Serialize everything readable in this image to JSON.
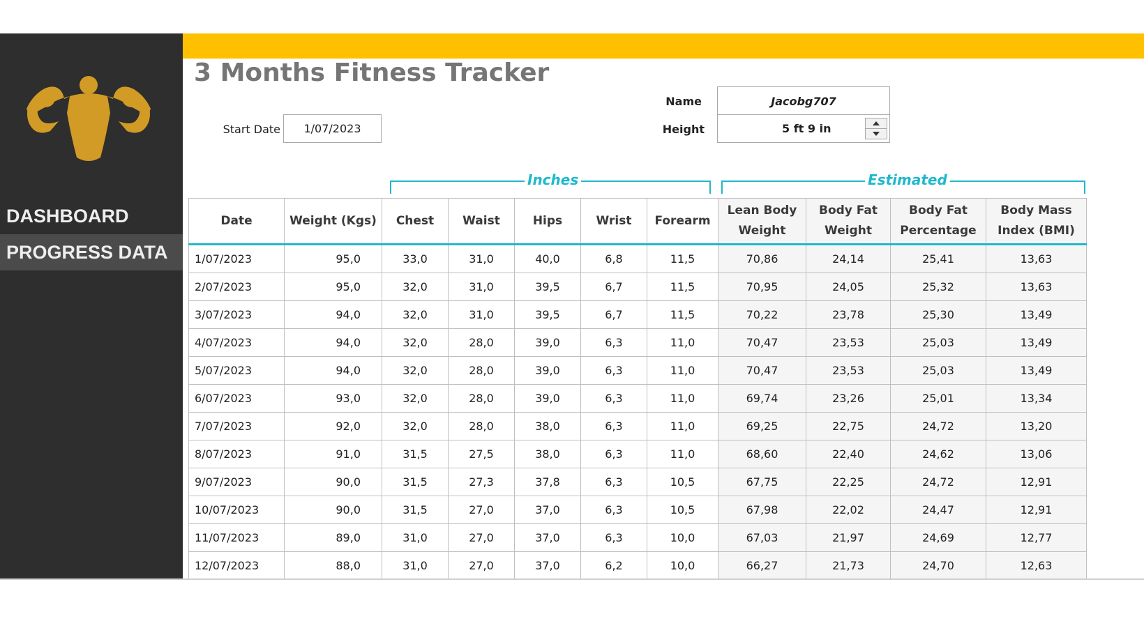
{
  "sidebar": {
    "logo_icon": "flexing-bodybuilder-icon",
    "logo_color": "#d19b25",
    "items": [
      {
        "label": "DASHBOARD"
      },
      {
        "label": "PROGRESS DATA"
      }
    ]
  },
  "header": {
    "accent_color": "#ffc000",
    "title": "3 Months Fitness Tracker"
  },
  "form": {
    "start_date_label": "Start Date",
    "start_date": "1/07/2023",
    "name_label": "Name",
    "name": "Jacobg707",
    "height_label": "Height",
    "height": "5 ft 9 in"
  },
  "groups": {
    "inches": "Inches",
    "estimated": "Estimated",
    "color": "#1fb8cd"
  },
  "table": {
    "headers": [
      {
        "l1": "Date",
        "l2": ""
      },
      {
        "l1": "Weight (Kgs)",
        "l2": ""
      },
      {
        "l1": "Chest",
        "l2": ""
      },
      {
        "l1": "Waist",
        "l2": ""
      },
      {
        "l1": "Hips",
        "l2": ""
      },
      {
        "l1": "Wrist",
        "l2": ""
      },
      {
        "l1": "Forearm",
        "l2": ""
      },
      {
        "l1": "Lean Body",
        "l2": "Weight"
      },
      {
        "l1": "Body Fat",
        "l2": "Weight"
      },
      {
        "l1": "Body Fat",
        "l2": "Percentage"
      },
      {
        "l1": "Body Mass",
        "l2": "Index (BMI)"
      }
    ],
    "rows": [
      [
        "1/07/2023",
        "95,0",
        "33,0",
        "31,0",
        "40,0",
        "6,8",
        "11,5",
        "70,86",
        "24,14",
        "25,41",
        "13,63"
      ],
      [
        "2/07/2023",
        "95,0",
        "32,0",
        "31,0",
        "39,5",
        "6,7",
        "11,5",
        "70,95",
        "24,05",
        "25,32",
        "13,63"
      ],
      [
        "3/07/2023",
        "94,0",
        "32,0",
        "31,0",
        "39,5",
        "6,7",
        "11,5",
        "70,22",
        "23,78",
        "25,30",
        "13,49"
      ],
      [
        "4/07/2023",
        "94,0",
        "32,0",
        "28,0",
        "39,0",
        "6,3",
        "11,0",
        "70,47",
        "23,53",
        "25,03",
        "13,49"
      ],
      [
        "5/07/2023",
        "94,0",
        "32,0",
        "28,0",
        "39,0",
        "6,3",
        "11,0",
        "70,47",
        "23,53",
        "25,03",
        "13,49"
      ],
      [
        "6/07/2023",
        "93,0",
        "32,0",
        "28,0",
        "39,0",
        "6,3",
        "11,0",
        "69,74",
        "23,26",
        "25,01",
        "13,34"
      ],
      [
        "7/07/2023",
        "92,0",
        "32,0",
        "28,0",
        "38,0",
        "6,3",
        "11,0",
        "69,25",
        "22,75",
        "24,72",
        "13,20"
      ],
      [
        "8/07/2023",
        "91,0",
        "31,5",
        "27,5",
        "38,0",
        "6,3",
        "11,0",
        "68,60",
        "22,40",
        "24,62",
        "13,06"
      ],
      [
        "9/07/2023",
        "90,0",
        "31,5",
        "27,3",
        "37,8",
        "6,3",
        "10,5",
        "67,75",
        "22,25",
        "24,72",
        "12,91"
      ],
      [
        "10/07/2023",
        "90,0",
        "31,5",
        "27,0",
        "37,0",
        "6,3",
        "10,5",
        "67,98",
        "22,02",
        "24,47",
        "12,91"
      ],
      [
        "11/07/2023",
        "89,0",
        "31,0",
        "27,0",
        "37,0",
        "6,3",
        "10,0",
        "67,03",
        "21,97",
        "24,69",
        "12,77"
      ],
      [
        "12/07/2023",
        "88,0",
        "31,0",
        "27,0",
        "37,0",
        "6,2",
        "10,0",
        "66,27",
        "21,73",
        "24,70",
        "12,63"
      ]
    ]
  }
}
